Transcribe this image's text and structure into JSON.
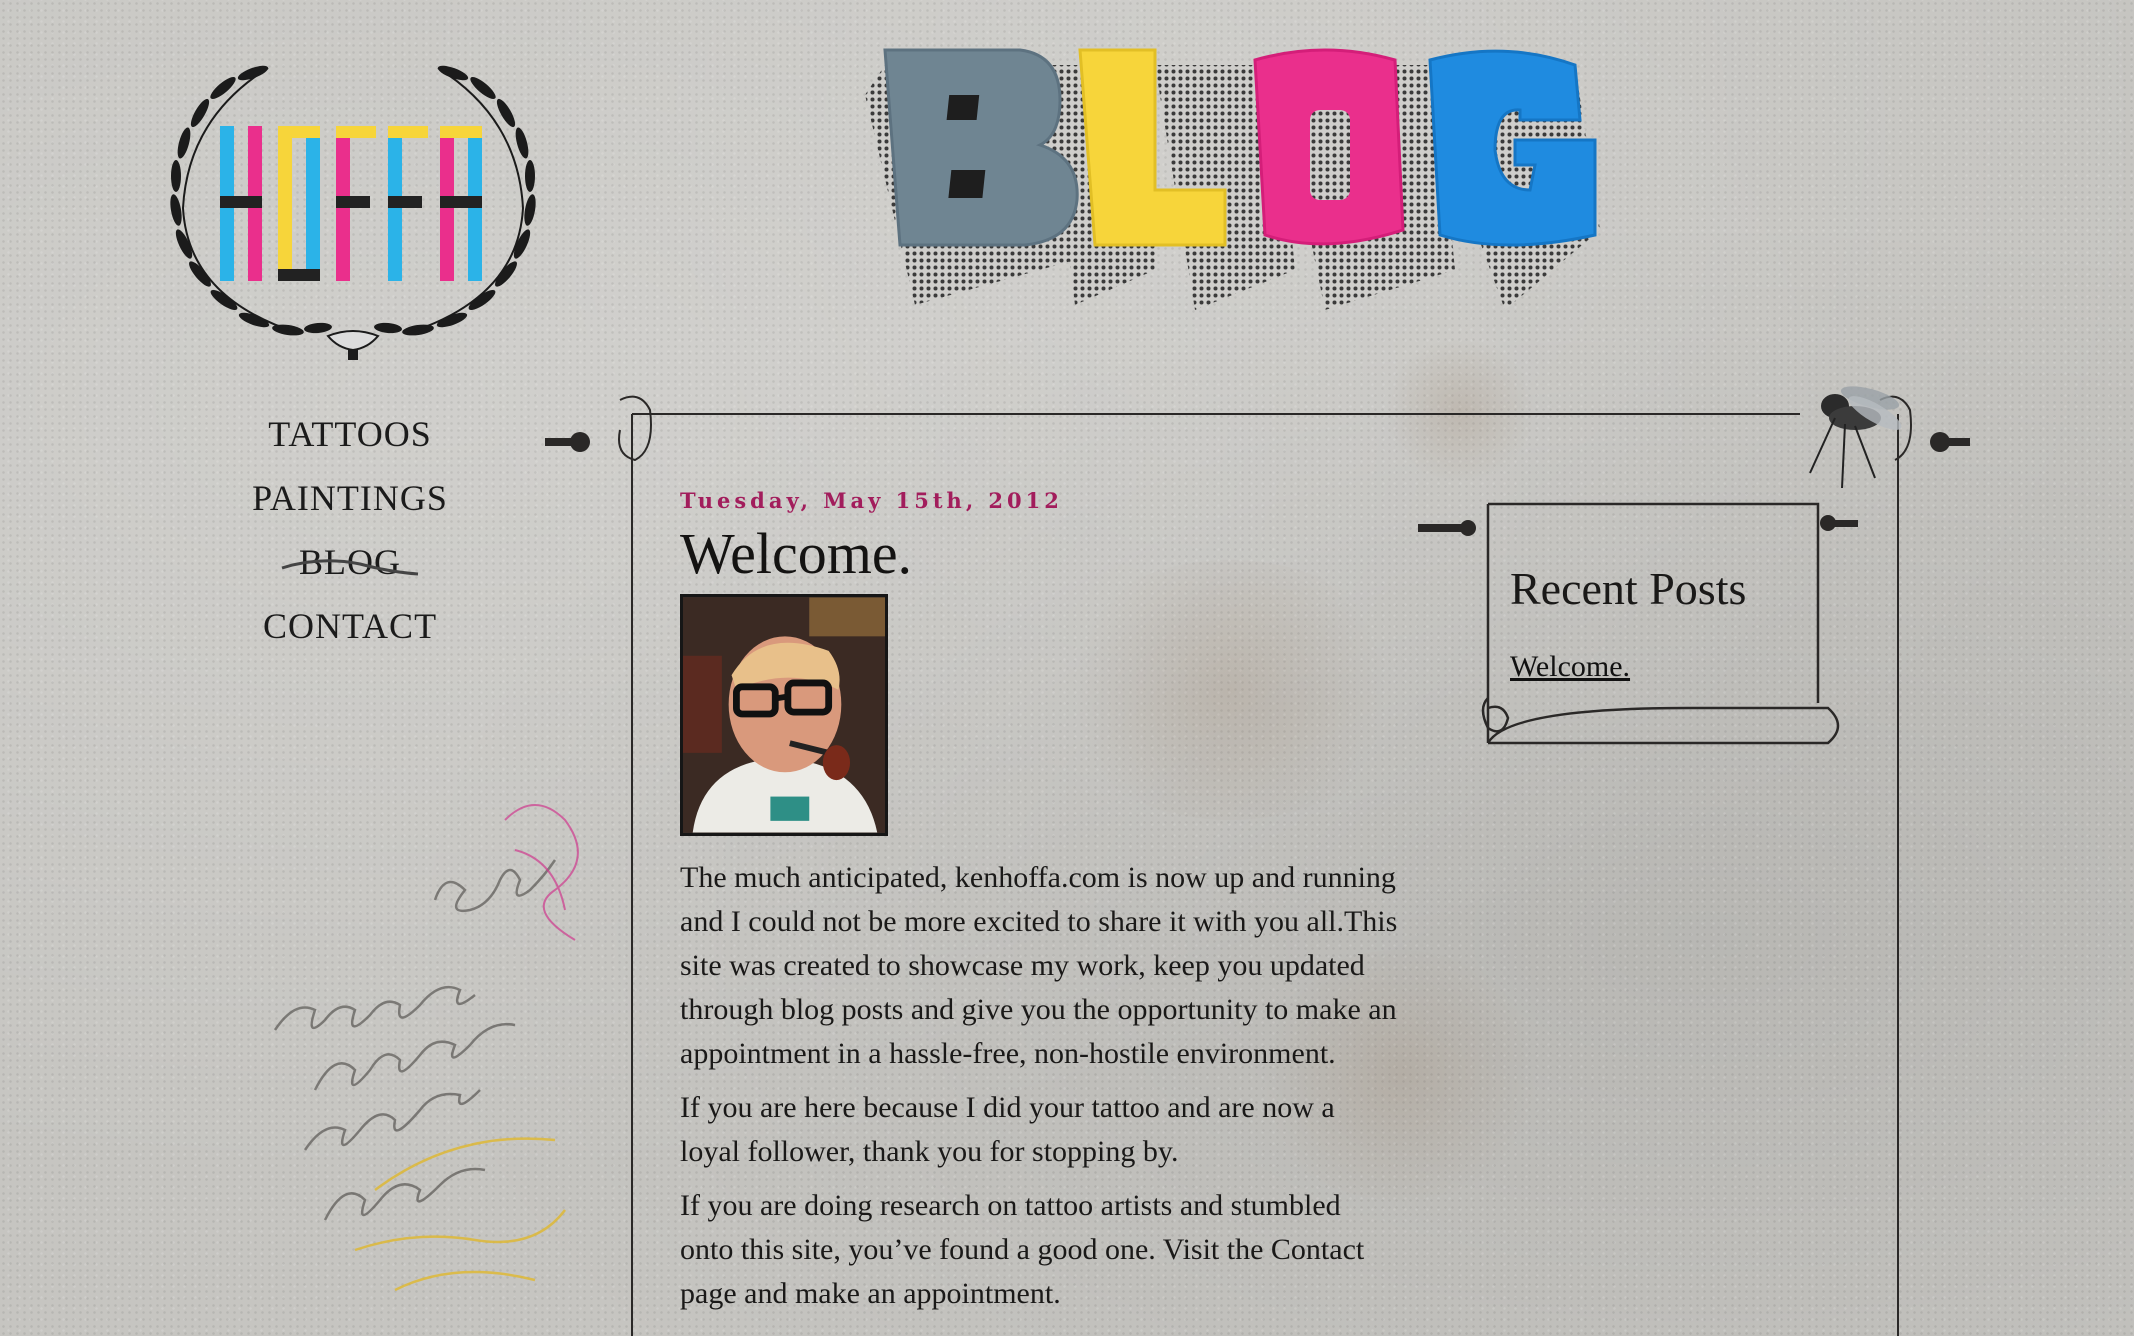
{
  "logo": {
    "text": "HOFFA"
  },
  "header": {
    "title": "BLOG"
  },
  "nav": {
    "items": [
      {
        "label": "TATTOOS"
      },
      {
        "label": "PAINTINGS"
      },
      {
        "label": "BLOG",
        "current": true
      },
      {
        "label": "CONTACT"
      }
    ]
  },
  "post": {
    "date": "Tuesday, May 15th, 2012",
    "title": "Welcome.",
    "paragraphs": [
      "The much anticipated, kenhoffa.com is now up and running and I could not be more excited to share it with you all.This site was created to showcase my work, keep you updated through blog posts and give you the opportunity to make an appointment in a hassle-free, non-hostile environment.",
      "If you are here because I did your tattoo and are now a loyal follower, thank you for stopping by.",
      "If you are doing research on tattoo artists and stumbled onto this site, you’ve found a good one. Visit the Contact page and make an appointment."
    ]
  },
  "sidebar": {
    "title": "Recent Posts",
    "links": [
      {
        "label": "Welcome."
      }
    ]
  },
  "colors": {
    "cyan": "#2bb3e8",
    "magenta": "#ea2f8c",
    "yellow": "#f7d53a",
    "blue": "#1f8be0",
    "slate": "#6f8592",
    "date": "#a21d5c"
  },
  "icons": [
    "laurel-wreath-icon",
    "fly-icon",
    "scroll-icon",
    "pipe-photo"
  ]
}
